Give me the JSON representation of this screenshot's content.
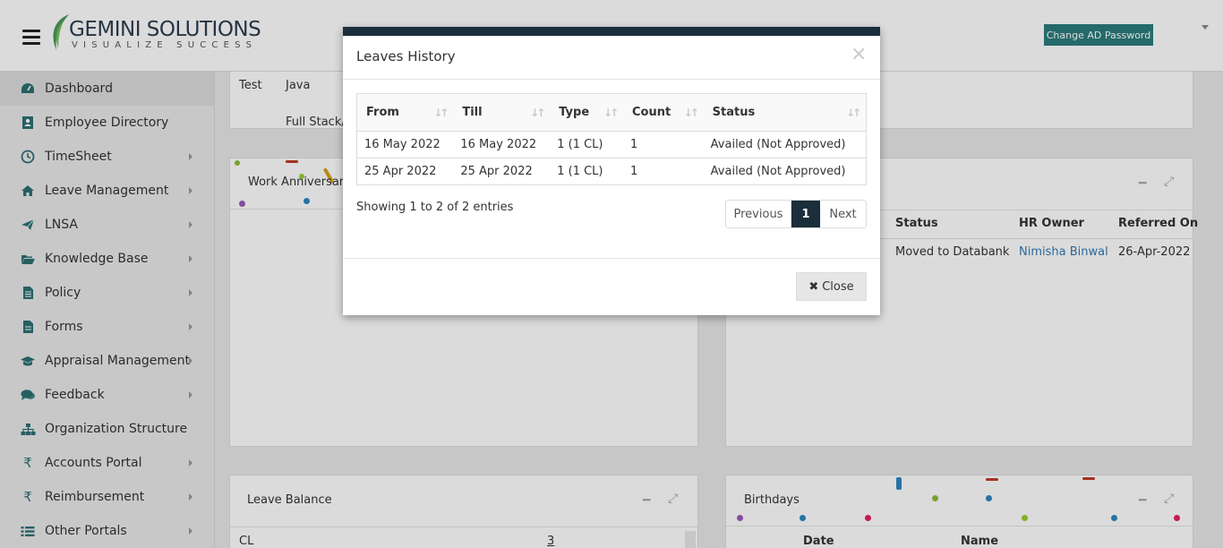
{
  "header": {
    "logo_name": "GEMINI SOLUTIONS",
    "logo_tagline": "VISUALIZE SUCCESS",
    "change_password_label": "Change AD Password",
    "brand_color": "#2c7c7c"
  },
  "sidebar": {
    "items": [
      {
        "label": "Dashboard",
        "icon": "dashboard-icon",
        "has_submenu": false,
        "active": true
      },
      {
        "label": "Employee Directory",
        "icon": "address-book-icon",
        "has_submenu": false
      },
      {
        "label": "TimeSheet",
        "icon": "clock-icon",
        "has_submenu": true
      },
      {
        "label": "Leave Management",
        "icon": "home-icon",
        "has_submenu": true
      },
      {
        "label": "LNSA",
        "icon": "paper-plane-icon",
        "has_submenu": true
      },
      {
        "label": "Knowledge Base",
        "icon": "folder-open-icon",
        "has_submenu": true
      },
      {
        "label": "Policy",
        "icon": "file-text-icon",
        "has_submenu": true
      },
      {
        "label": "Forms",
        "icon": "file-icon",
        "has_submenu": true
      },
      {
        "label": "Appraisal Management",
        "icon": "graduation-cap-icon",
        "has_submenu": true
      },
      {
        "label": "Feedback",
        "icon": "comments-icon",
        "has_submenu": true
      },
      {
        "label": "Organization Structure",
        "icon": "sitemap-icon",
        "has_submenu": false
      },
      {
        "label": "Accounts Portal",
        "icon": "rupee-icon",
        "has_submenu": true
      },
      {
        "label": "Reimbursement",
        "icon": "rupee-icon",
        "has_submenu": true
      },
      {
        "label": "Other Portals",
        "icon": "list-icon",
        "has_submenu": true
      }
    ]
  },
  "background": {
    "top_panel": {
      "row1": [
        "Test",
        "Java"
      ],
      "row2_partial": "Full Stack/"
    },
    "work_anniversary": {
      "title": "Work Anniversary"
    },
    "referral_panel": {
      "headers": [
        "Status",
        "HR Owner",
        "Referred On"
      ],
      "row": {
        "status": "Moved to Databank",
        "hr_owner": "Nimisha Binwal",
        "referred_on": "26-Apr-2022"
      }
    },
    "leave_balance": {
      "title": "Leave Balance",
      "row": {
        "type": "CL",
        "value": "3"
      }
    },
    "birthdays": {
      "title": "Birthdays",
      "headers": [
        "Date",
        "Name"
      ]
    }
  },
  "modal": {
    "title": "Leaves History",
    "columns": [
      "From",
      "Till",
      "Type",
      "Count",
      "Status"
    ],
    "rows": [
      {
        "from": "16 May 2022",
        "till": "16 May 2022",
        "type": "1 (1 CL)",
        "count": "1",
        "status": "Availed (Not Approved)"
      },
      {
        "from": "25 Apr 2022",
        "till": "25 Apr 2022",
        "type": "1 (1 CL)",
        "count": "1",
        "status": "Availed (Not Approved)"
      }
    ],
    "entries_info": "Showing 1 to 2 of 2 entries",
    "pagination": {
      "previous": "Previous",
      "current": "1",
      "next": "Next"
    },
    "close_label": "Close",
    "dismiss_glyph": "×",
    "accent_color": "#1a2e3b"
  }
}
